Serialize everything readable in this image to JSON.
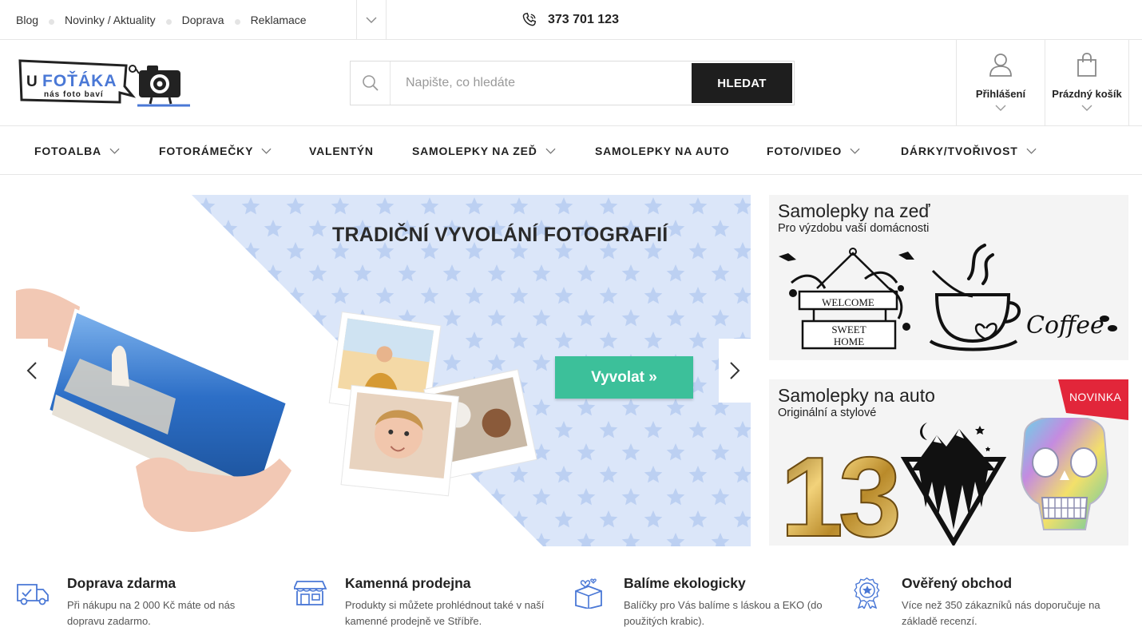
{
  "topbar": {
    "links": [
      "Blog",
      "Novinky / Aktuality",
      "Doprava",
      "Reklamace"
    ],
    "phone": "373 701 123"
  },
  "logo": {
    "brand": "U FOŤÁKA",
    "tagline": "nás foto baví"
  },
  "search": {
    "placeholder": "Napište, co hledáte",
    "button": "HLEDAT"
  },
  "account": {
    "login": "Přihlášení",
    "cart": "Prázdný košík"
  },
  "nav": {
    "items": [
      {
        "label": "FOTOALBA",
        "dropdown": true
      },
      {
        "label": "FOTORÁMEČKY",
        "dropdown": true
      },
      {
        "label": "VALENTÝN",
        "dropdown": false
      },
      {
        "label": "SAMOLEPKY NA ZEĎ",
        "dropdown": true
      },
      {
        "label": "SAMOLEPKY NA AUTO",
        "dropdown": false
      },
      {
        "label": "FOTO/VIDEO",
        "dropdown": true
      },
      {
        "label": "DÁRKY/TVOŘIVOST",
        "dropdown": true
      }
    ]
  },
  "hero": {
    "title": "TRADIČNÍ VYVOLÁNÍ FOTOGRAFIÍ",
    "cta": "Vyvolat »"
  },
  "side": {
    "wall": {
      "title": "Samolepky na zeď",
      "subtitle": "Pro výzdobu vaší domácnosti",
      "sign_lines": [
        "WELCOME",
        "SWEET",
        "HOME"
      ],
      "coffee": "Coffee"
    },
    "car": {
      "title": "Samolepky na auto",
      "subtitle": "Originální a stylové",
      "badge": "NOVINKA",
      "number": "13"
    }
  },
  "features": [
    {
      "title": "Doprava zdarma",
      "desc": "Při nákupu na 2 000 Kč máte od nás dopravu zadarmo."
    },
    {
      "title": "Kamenná prodejna",
      "desc": "Produkty si můžete prohlédnout také v naší kamenné prodejně ve Stříbře."
    },
    {
      "title": "Balíme ekologicky",
      "desc": "Balíčky pro Vás balíme s láskou a EKO (do použitých krabic)."
    },
    {
      "title": "Ověřený obchod",
      "desc": "Více než 350 zákazníků nás doporučuje na základě recenzí."
    }
  ],
  "colors": {
    "accent": "#3cc09a",
    "badge": "#e2263a",
    "logo_blue": "#4a78d6",
    "dark": "#1e1e1e"
  }
}
